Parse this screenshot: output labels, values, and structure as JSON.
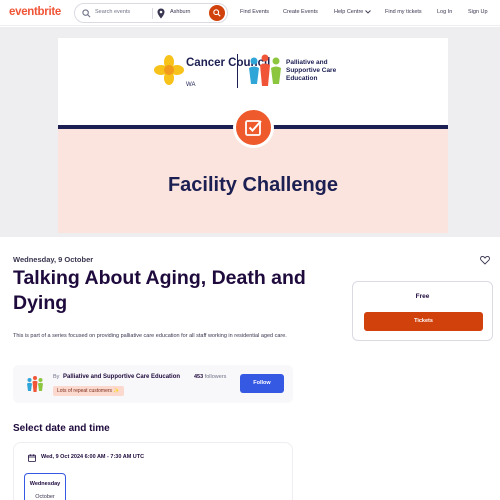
{
  "header": {
    "logo": "eventbrite",
    "search_placeholder": "Search events",
    "location": "Ashburn",
    "nav": {
      "find_events": "Find Events",
      "create_events": "Create Events",
      "help_centre": "Help Centre",
      "find_tickets": "Find my tickets",
      "log_in": "Log In",
      "sign_up": "Sign Up"
    }
  },
  "hero": {
    "cancer_council": "Cancer Council",
    "cancer_council_region": "WA",
    "partner_line_1": "Palliative and",
    "partner_line_2": "Supportive Care",
    "partner_line_3": "Education",
    "banner_title": "Facility Challenge"
  },
  "event": {
    "date": "Wednesday, 9 October",
    "title": "Talking About Aging, Death and Dying",
    "summary": "This is part of a series focused on providing palliative care education for all staff working in residential aged care."
  },
  "organizer": {
    "by_label": "By",
    "name": "Palliative and Supportive Care Education",
    "followers_count": "453",
    "followers_label": "followers",
    "badge": "Lots of repeat customers",
    "follow_label": "Follow"
  },
  "select_date": {
    "heading": "Select date and time",
    "datetime": "Wed, 9 Oct 2024 6:00 AM - 7:30 AM UTC",
    "tile_day": "Wednesday",
    "tile_month": "October"
  },
  "ticket": {
    "price": "Free",
    "button_label": "Tickets"
  },
  "colors": {
    "brand_orange": "#f05537",
    "ticket_button": "#d1410c",
    "follow_button": "#3659e3",
    "navy": "#1c1f52",
    "banner_pink": "#fbe4dd"
  },
  "icons": [
    "search-icon",
    "location-pin-icon",
    "chevron-down-icon",
    "heart-icon",
    "calendar-icon",
    "checkbox-icon",
    "daffodil-icon",
    "people-logo-icon"
  ]
}
